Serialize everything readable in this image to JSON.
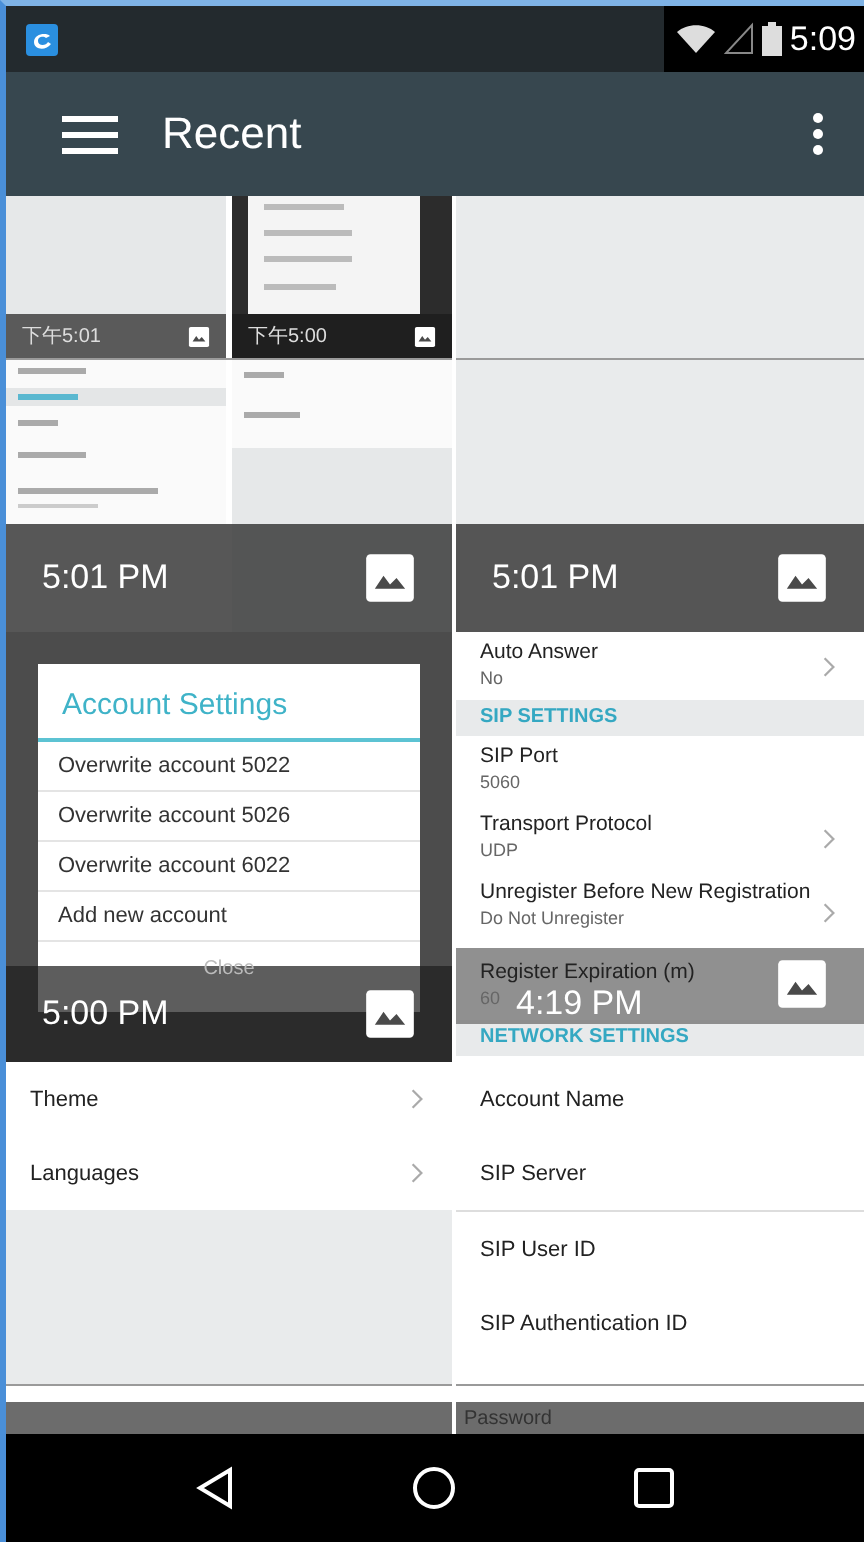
{
  "status_bar": {
    "time": "5:09"
  },
  "app_bar": {
    "title": "Recent"
  },
  "tiles": [
    {
      "kind": "nested",
      "sub_captions": [
        "下午5:01",
        "下午5:00"
      ],
      "time": "5:01 PM"
    },
    {
      "kind": "blank",
      "time": "5:01 PM"
    },
    {
      "kind": "dialog",
      "title": "Account Settings",
      "items": [
        "Overwrite account 5022",
        "Overwrite account 5026",
        "Overwrite account 6022",
        "Add new account"
      ],
      "button": "Close",
      "time": "5:00 PM"
    },
    {
      "kind": "settings",
      "rows": [
        {
          "kind": "item",
          "title": "Auto Answer",
          "value": "No",
          "chevron": true
        },
        {
          "kind": "header",
          "title": "SIP SETTINGS"
        },
        {
          "kind": "item",
          "title": "SIP Port",
          "value": "5060",
          "chevron": false
        },
        {
          "kind": "item",
          "title": "Transport Protocol",
          "value": "UDP",
          "chevron": true
        },
        {
          "kind": "item",
          "title": "Unregister Before New Registration",
          "value": "Do Not Unregister",
          "chevron": true
        },
        {
          "kind": "item",
          "title": "Register Expiration (m)",
          "value": "60",
          "chevron": false
        },
        {
          "kind": "header",
          "title": "NETWORK SETTINGS"
        }
      ],
      "time": "4:19 PM"
    },
    {
      "kind": "list",
      "rows": [
        {
          "kind": "item",
          "title": "Theme",
          "chevron": true
        },
        {
          "kind": "item",
          "title": "Languages",
          "chevron": true
        },
        {
          "kind": "blank"
        }
      ]
    },
    {
      "kind": "list",
      "rows": [
        {
          "kind": "item",
          "title": "Account Name",
          "chevron": false
        },
        {
          "kind": "item",
          "title": "SIP Server",
          "chevron": false
        },
        {
          "kind": "divider"
        },
        {
          "kind": "item",
          "title": "SIP User ID",
          "chevron": false
        },
        {
          "kind": "item",
          "title": "SIP Authentication ID",
          "chevron": false
        }
      ],
      "footer": "Password"
    }
  ]
}
